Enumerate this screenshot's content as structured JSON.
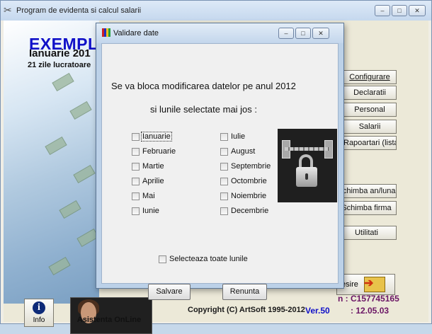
{
  "main_window": {
    "title": "Program de evidenta si calcul salarii",
    "controls": {
      "minimize": "–",
      "maximize": "□",
      "close": "✕"
    }
  },
  "header": {
    "company": "EXEMPLU",
    "period": "Ianuarie 201",
    "work_days": "21 zile lucratoare"
  },
  "side_buttons": {
    "configurare": "Configurare",
    "declaratii": "Declaratii",
    "personal": "Personal",
    "salarii": "Salarii",
    "rapoarti": "Rapoartari (listari)",
    "schimba_an": "Schimba an/luna",
    "schimba_firma": "Schimba firma",
    "utilitati": "Utilitati",
    "iesire": "Iesire"
  },
  "footer": {
    "code_label": "n :",
    "code_value": "C157745165",
    "copyright": "Copyright (C) ArtSoft 1995-2012",
    "version_label": "Ver.50",
    "version_value": ":  12.05.03",
    "info_label": "Info",
    "support_label": "Asistenta OnLine"
  },
  "dialog": {
    "title": "Validare date",
    "message_line1": "Se va bloca modificarea datelor pe anul 2012",
    "message_line2": "si lunile selectate mai jos :",
    "months_left": [
      "Ianuarie",
      "Februarie",
      "Martie",
      "Aprilie",
      "Mai",
      "Iunie"
    ],
    "months_right": [
      "Iulie",
      "August",
      "Septembrie",
      "Octombrie",
      "Noiembrie",
      "Decembrie"
    ],
    "select_all_label": "Selecteaza toate lunile",
    "save_label": "Salvare",
    "cancel_label": "Renunta"
  },
  "icons": {
    "app": "money-icon",
    "dialog": "dialog-app-icon",
    "info": "info-icon",
    "exit": "exit-door-icon",
    "lock": "padlock-image"
  },
  "colors": {
    "company": "#1010c8",
    "version": "#1010c8",
    "code": "#6a1464",
    "dialog_border": "#bcd1e8"
  }
}
